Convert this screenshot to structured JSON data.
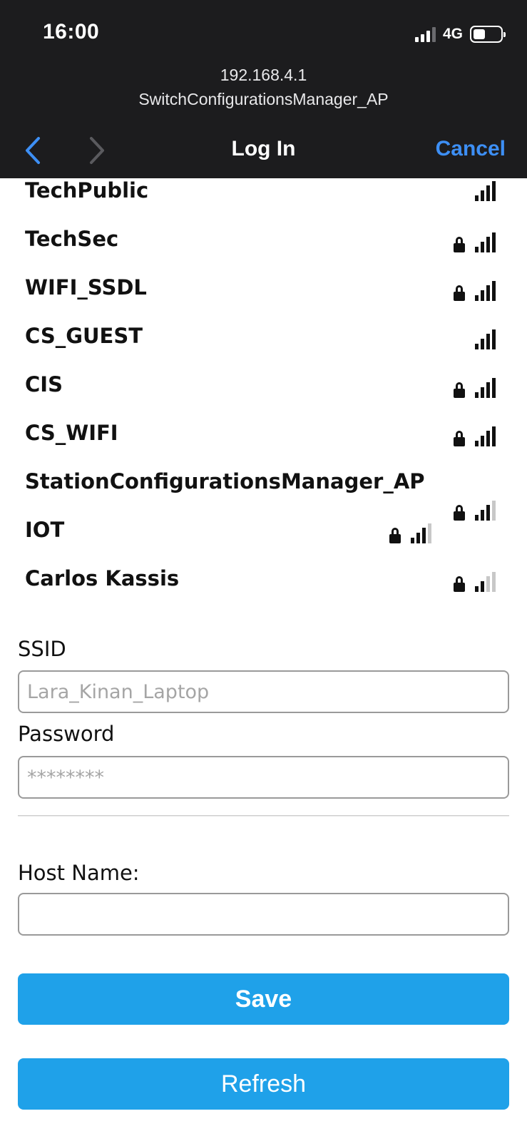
{
  "status_bar": {
    "time": "16:00",
    "network": "4G"
  },
  "browser": {
    "url": "192.168.4.1",
    "site_name": "SwitchConfigurationsManager_AP",
    "title": "Log In",
    "cancel_label": "Cancel"
  },
  "networks": [
    {
      "name": "TechPublic",
      "locked": false,
      "signal_bars": 4
    },
    {
      "name": "TechSec",
      "locked": true,
      "signal_bars": 4
    },
    {
      "name": "WIFI_SSDL",
      "locked": true,
      "signal_bars": 4
    },
    {
      "name": "CS_GUEST",
      "locked": false,
      "signal_bars": 4
    },
    {
      "name": "CIS",
      "locked": true,
      "signal_bars": 4
    },
    {
      "name": "CS_WIFI",
      "locked": true,
      "signal_bars": 4
    },
    {
      "name": "StationConfigurationsManager_AP",
      "locked": true,
      "signal_bars": 3
    },
    {
      "name": "IOT",
      "locked": true,
      "signal_bars": 3
    },
    {
      "name": "Carlos Kassis",
      "locked": true,
      "signal_bars": 2
    }
  ],
  "form": {
    "ssid_label": "SSID",
    "ssid_placeholder": "Lara_Kinan_Laptop",
    "password_label": "Password",
    "password_placeholder": "********",
    "hostname_label": "Host Name:",
    "hostname_value": "",
    "save_label": "Save",
    "refresh_label": "Refresh"
  },
  "colors": {
    "accent": "#1fa1e9",
    "nav_link": "#3d8ff5",
    "header_bg": "#1c1c1e"
  }
}
